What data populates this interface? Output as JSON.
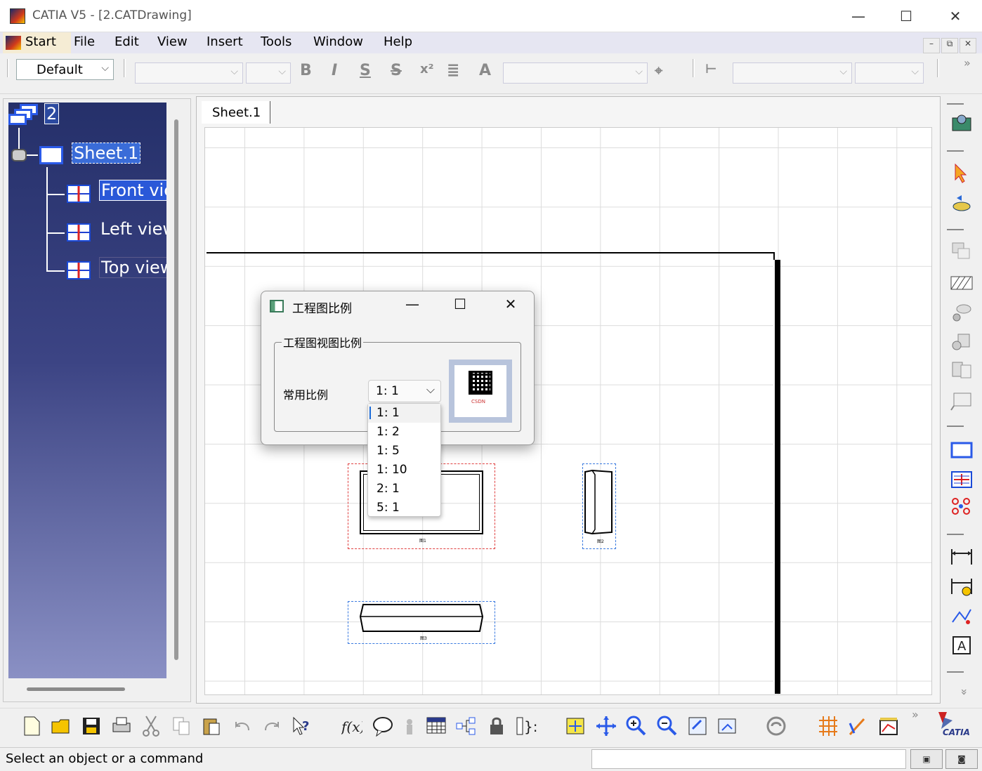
{
  "window": {
    "title": "CATIA V5 - [2.CATDrawing]",
    "minimize": "—",
    "maximize": "☐",
    "close": "✕"
  },
  "menu": {
    "start": "Start",
    "items": [
      "File",
      "Edit",
      "View",
      "Insert",
      "Tools",
      "Window",
      "Help"
    ]
  },
  "format_toolbar": {
    "style_value": "Default",
    "bold": "B",
    "italic": "I",
    "underline": "S",
    "strike": "S",
    "superscript": "x²",
    "text_props": "A"
  },
  "tree": {
    "root": "2",
    "sheet": "Sheet.1",
    "views": [
      "Front view",
      "Left view",
      "Top view"
    ]
  },
  "drawing": {
    "tab": "Sheet.1",
    "view_labels": [
      "图1",
      "图2",
      "图3"
    ]
  },
  "dialog": {
    "title": "工程图比例",
    "group_title": "工程图视图比例",
    "label": "常用比例",
    "selected": "1:  1",
    "options": [
      "1:  1",
      "1:  2",
      "1:  5",
      "1:  10",
      "2:  1",
      "5:  1"
    ],
    "qr_brand": "CSDN"
  },
  "status": {
    "text": "Select an object or a command"
  },
  "brand": {
    "logo_text": "CATIA"
  },
  "colors": {
    "tree_top": "#25306a",
    "tree_bottom": "#8a90c4",
    "selection_red": "#e04040",
    "selection_blue": "#3a7ae0"
  }
}
